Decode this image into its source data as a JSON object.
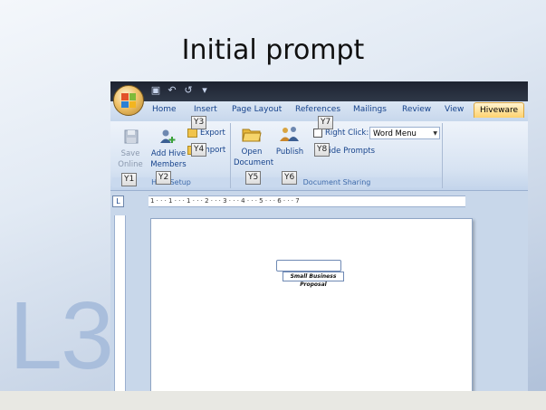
{
  "slide": {
    "title": "Initial prompt",
    "level_label": "L3"
  },
  "quick_access": {
    "icons": [
      "save-icon",
      "undo-icon",
      "redo-icon",
      "customize-icon"
    ]
  },
  "tabs": [
    {
      "label": "Home"
    },
    {
      "label": "Insert"
    },
    {
      "label": "Page Layout"
    },
    {
      "label": "References"
    },
    {
      "label": "Mailings"
    },
    {
      "label": "Review"
    },
    {
      "label": "View"
    },
    {
      "label": "Hiveware",
      "active": true
    }
  ],
  "ribbon": {
    "hive_setup": {
      "label": "Hive Setup",
      "save_online": "Save Online",
      "add_hive_members": "Add Hive Members",
      "export": "Export",
      "import": "Import"
    },
    "document_sharing": {
      "label": "Document Sharing",
      "open_document": "Open Document",
      "publish": "Publish",
      "right_click_label": "Right Click:",
      "right_click_value": "Word Menu",
      "hide_prompts": "Hide Prompts"
    }
  },
  "keytips": {
    "y1": "Y1",
    "y2": "Y2",
    "y3": "Y3",
    "y4": "Y4",
    "y5": "Y5",
    "y6": "Y6",
    "y7": "Y7",
    "y8": "Y8"
  },
  "ruler": {
    "corner": "L",
    "marks": "1 · · · 1 · · · 1 · · · 2 · · · 3 · · · 4 · · · 5 · · · 6 · · · 7"
  },
  "document": {
    "textbox_text": "Small Business Proposal"
  },
  "colors": {
    "accent": "#15428b",
    "hiveware_tab": "#ffd26e",
    "level_label": "#a9bedc"
  }
}
